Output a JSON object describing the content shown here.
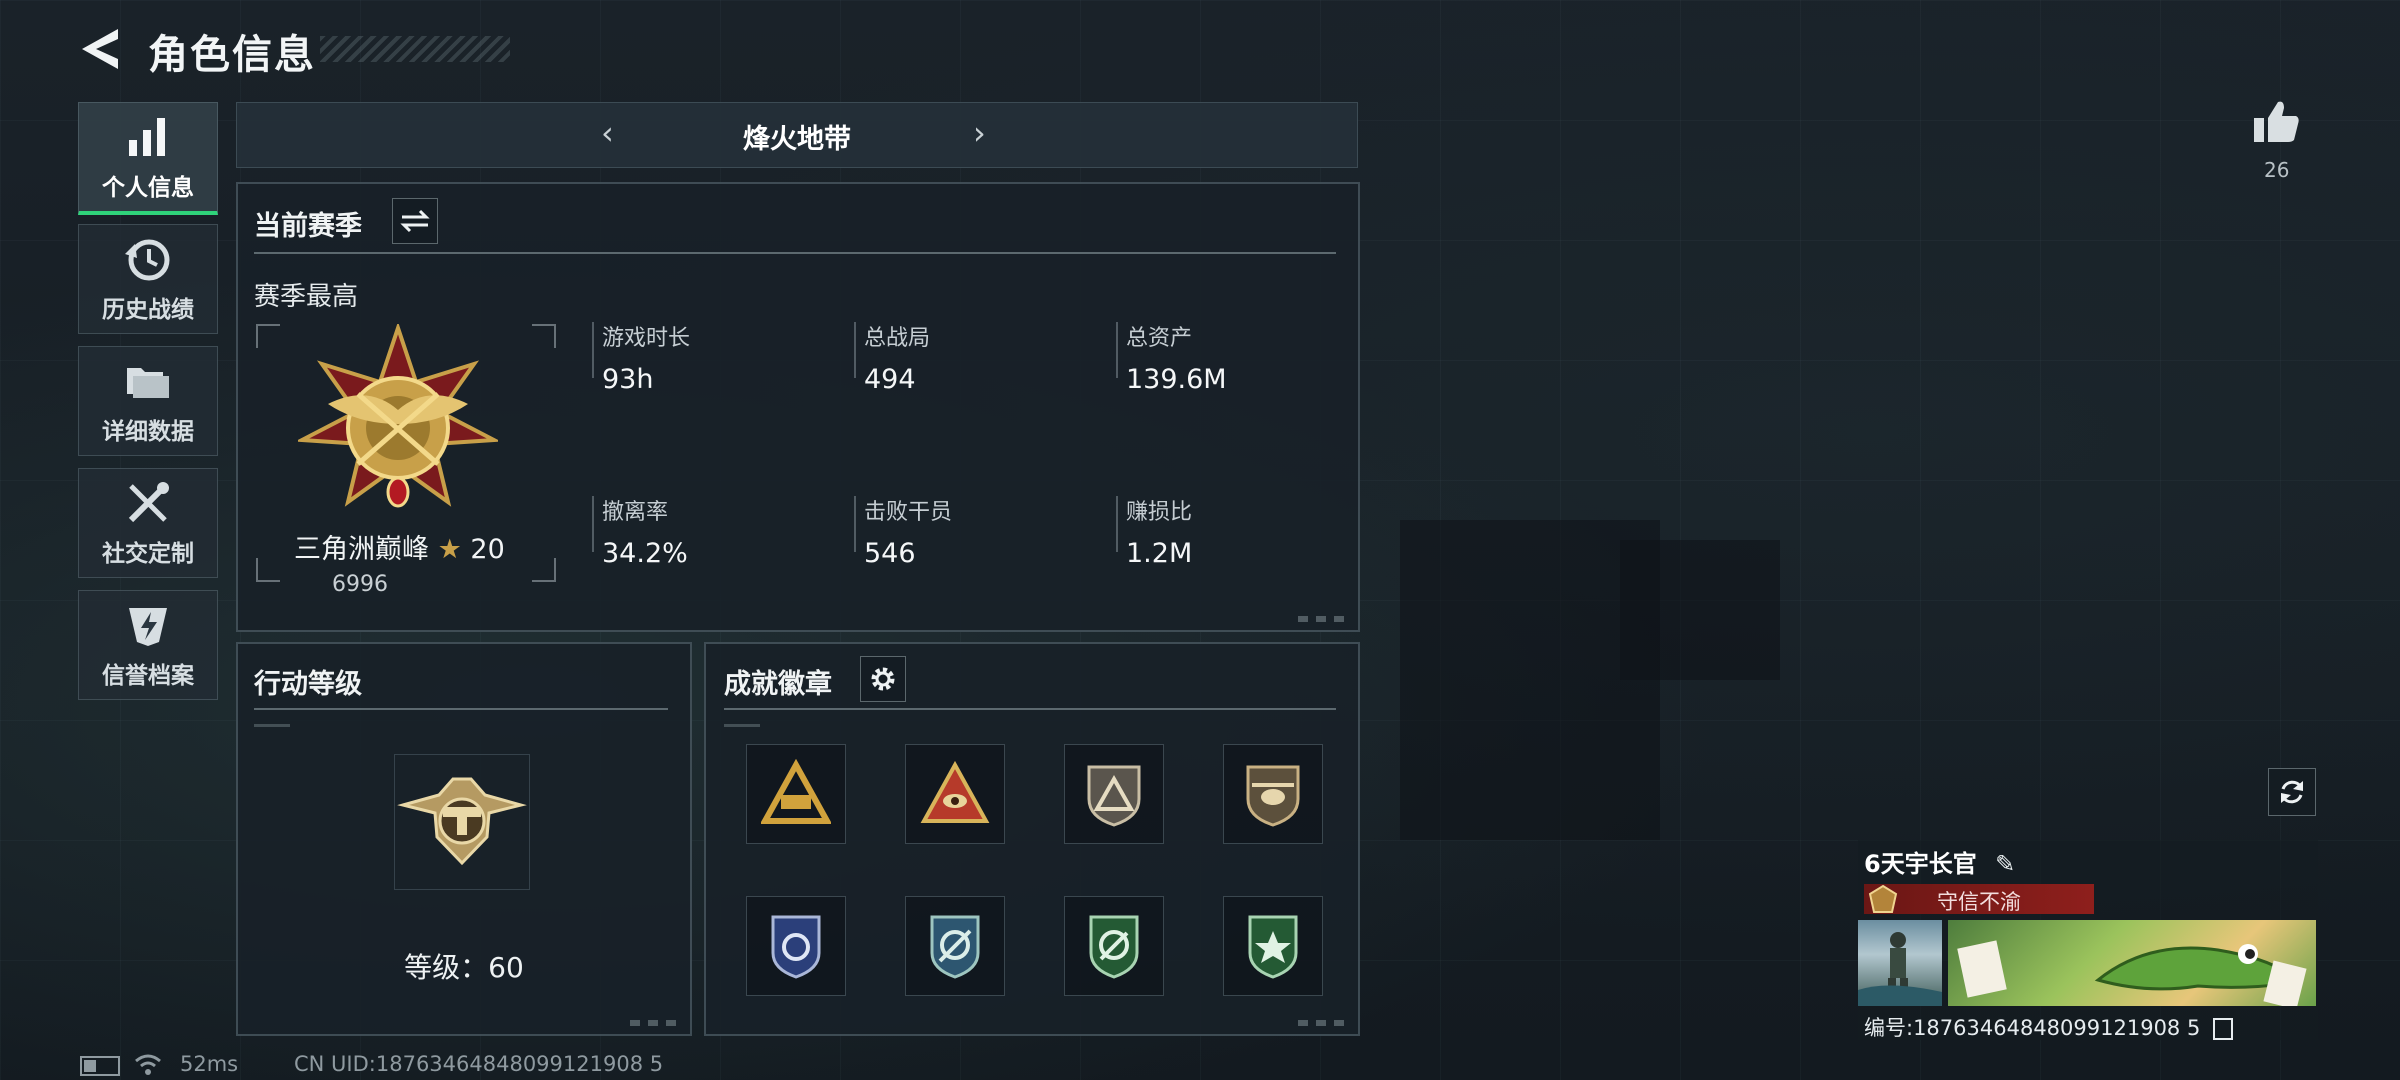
{
  "header": {
    "title": "角色信息"
  },
  "nav": [
    {
      "label": "个人信息",
      "icon": "bar-chart-icon",
      "active": true
    },
    {
      "label": "历史战绩",
      "icon": "history-clock-icon",
      "active": false
    },
    {
      "label": "详细数据",
      "icon": "folder-icon",
      "active": false
    },
    {
      "label": "社交定制",
      "icon": "wrench-screwdriver-icon",
      "active": false
    },
    {
      "label": "信誉档案",
      "icon": "shield-bolt-icon",
      "active": false
    }
  ],
  "mode": {
    "title": "烽火地带",
    "prev": "‹",
    "next": "›"
  },
  "season": {
    "title": "当前赛季",
    "best_label": "赛季最高",
    "rank_name": "三角洲巅峰",
    "rank_stars": "20",
    "rank_score": "6996",
    "stats": [
      {
        "label": "游戏时长",
        "value": "93h"
      },
      {
        "label": "总战局",
        "value": "494"
      },
      {
        "label": "总资产",
        "value": "139.6M"
      },
      {
        "label": "撤离率",
        "value": "34.2%"
      },
      {
        "label": "击败干员",
        "value": "546"
      },
      {
        "label": "赚损比",
        "value": "1.2M"
      }
    ]
  },
  "action_level": {
    "title": "行动等级",
    "level_text": "等级：60"
  },
  "achievements": {
    "title": "成就徽章",
    "badges": [
      {
        "icon": "triangle-emblem-icon",
        "color": "#d1a23c"
      },
      {
        "icon": "eye-triangle-icon",
        "color": "#b63a2a"
      },
      {
        "icon": "triangle-shield-icon",
        "color": "#9a9388"
      },
      {
        "icon": "helicopter-shield-icon",
        "color": "#8f8066"
      },
      {
        "icon": "blue-shield-icon",
        "color": "#3c56a8"
      },
      {
        "icon": "blue-green-shield-icon",
        "color": "#3a6f8f"
      },
      {
        "icon": "green-crosshair-shield-icon",
        "color": "#2f7a43"
      },
      {
        "icon": "green-star-shield-icon",
        "color": "#2f7a43"
      }
    ]
  },
  "likes": {
    "count": "26"
  },
  "profile": {
    "name": "6天宇长官",
    "motto": "守信不渝",
    "id_text": "编号:18763464848099121908 5"
  },
  "status_bar": {
    "ping": "52ms",
    "uid": "CN UID:18763464848099121908 5"
  },
  "colors": {
    "accent_green": "#2fd37a",
    "gold": "#c8a049",
    "motto_red": "#8e1f1c"
  }
}
